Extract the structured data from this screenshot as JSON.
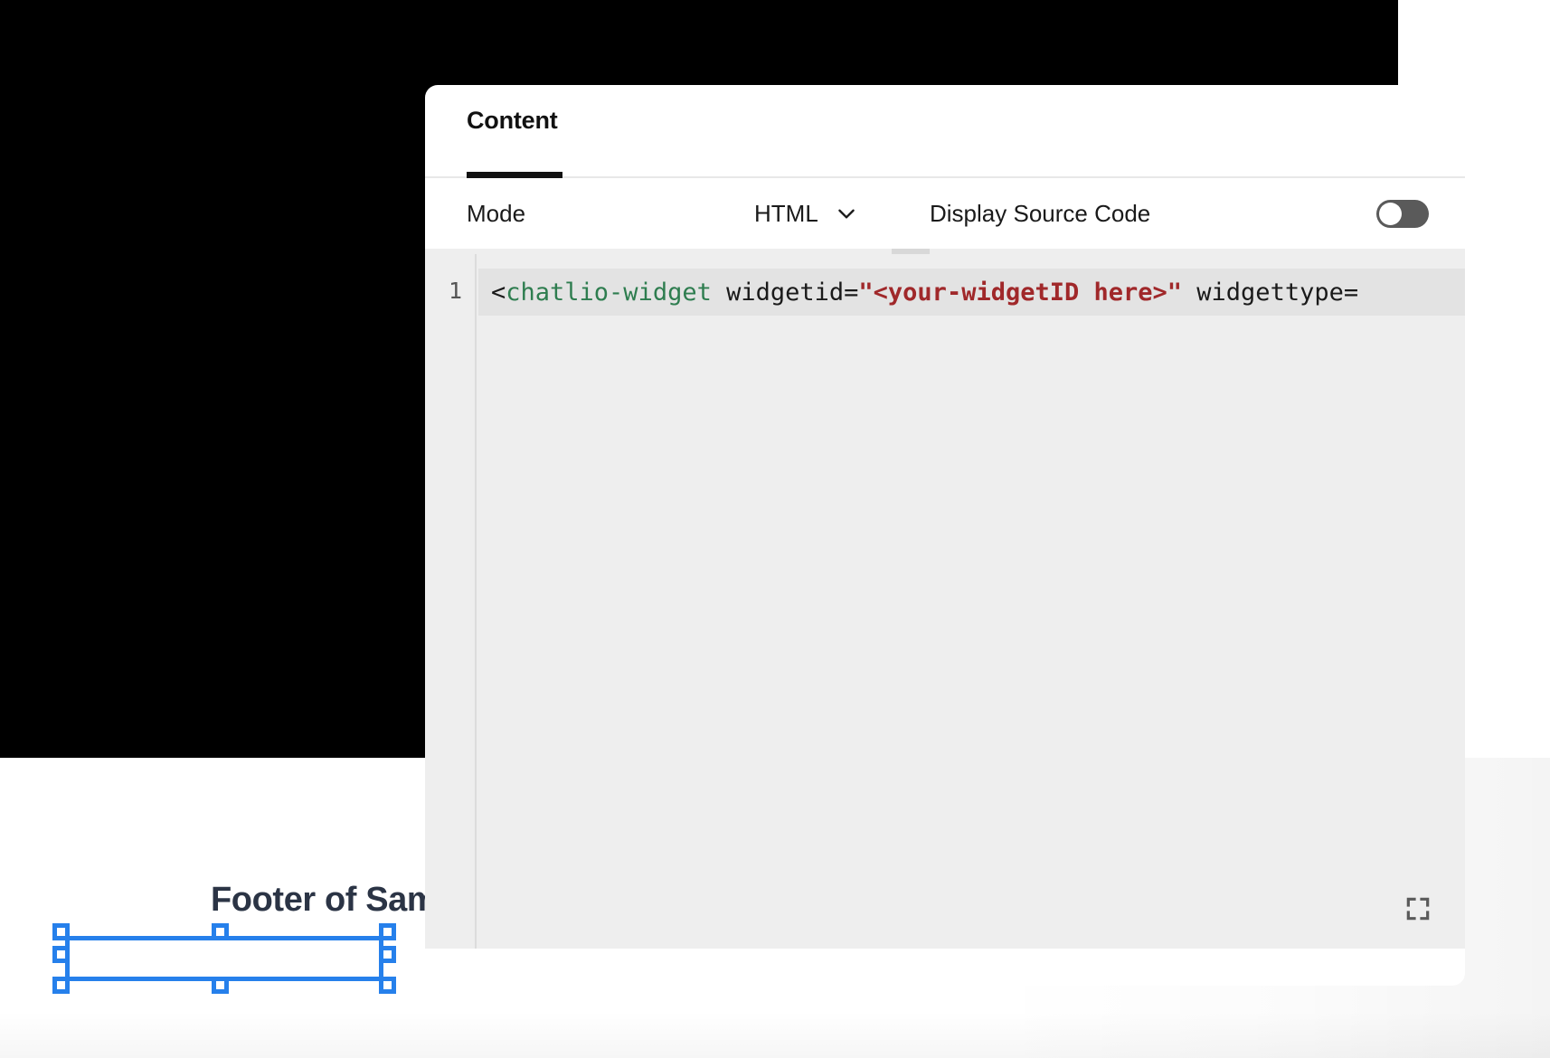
{
  "canvas": {
    "footer_heading": "Footer of Sample",
    "selection": {
      "name": "element-selection-box",
      "color": "#2680eb",
      "handle_count": 8
    }
  },
  "dialog": {
    "tabs": [
      {
        "label": "Content",
        "active": true
      }
    ],
    "controls": {
      "mode_label": "Mode",
      "mode_value": "HTML",
      "mode_chevron_icon": "chevron-down-icon",
      "display_source_label": "Display Source Code",
      "display_source_enabled": false,
      "toggle_color": "#5a5a5a"
    },
    "editor": {
      "line_numbers": [
        "1"
      ],
      "expand_icon": "expand-fullscreen-icon",
      "background": "#eeeeee",
      "active_line_background": "#e3e3e3",
      "code_tokens": [
        {
          "text": "<",
          "type": "punct"
        },
        {
          "text": "chatlio-widget",
          "type": "tag"
        },
        {
          "text": " widgetid=",
          "type": "attr"
        },
        {
          "text": "\"<your-widgetID here>\"",
          "type": "string"
        },
        {
          "text": " widgettype=",
          "type": "attr"
        }
      ],
      "code_colors": {
        "tag": "#2e7d4f",
        "string": "#a0282a",
        "text": "#1a1a1a"
      }
    }
  }
}
